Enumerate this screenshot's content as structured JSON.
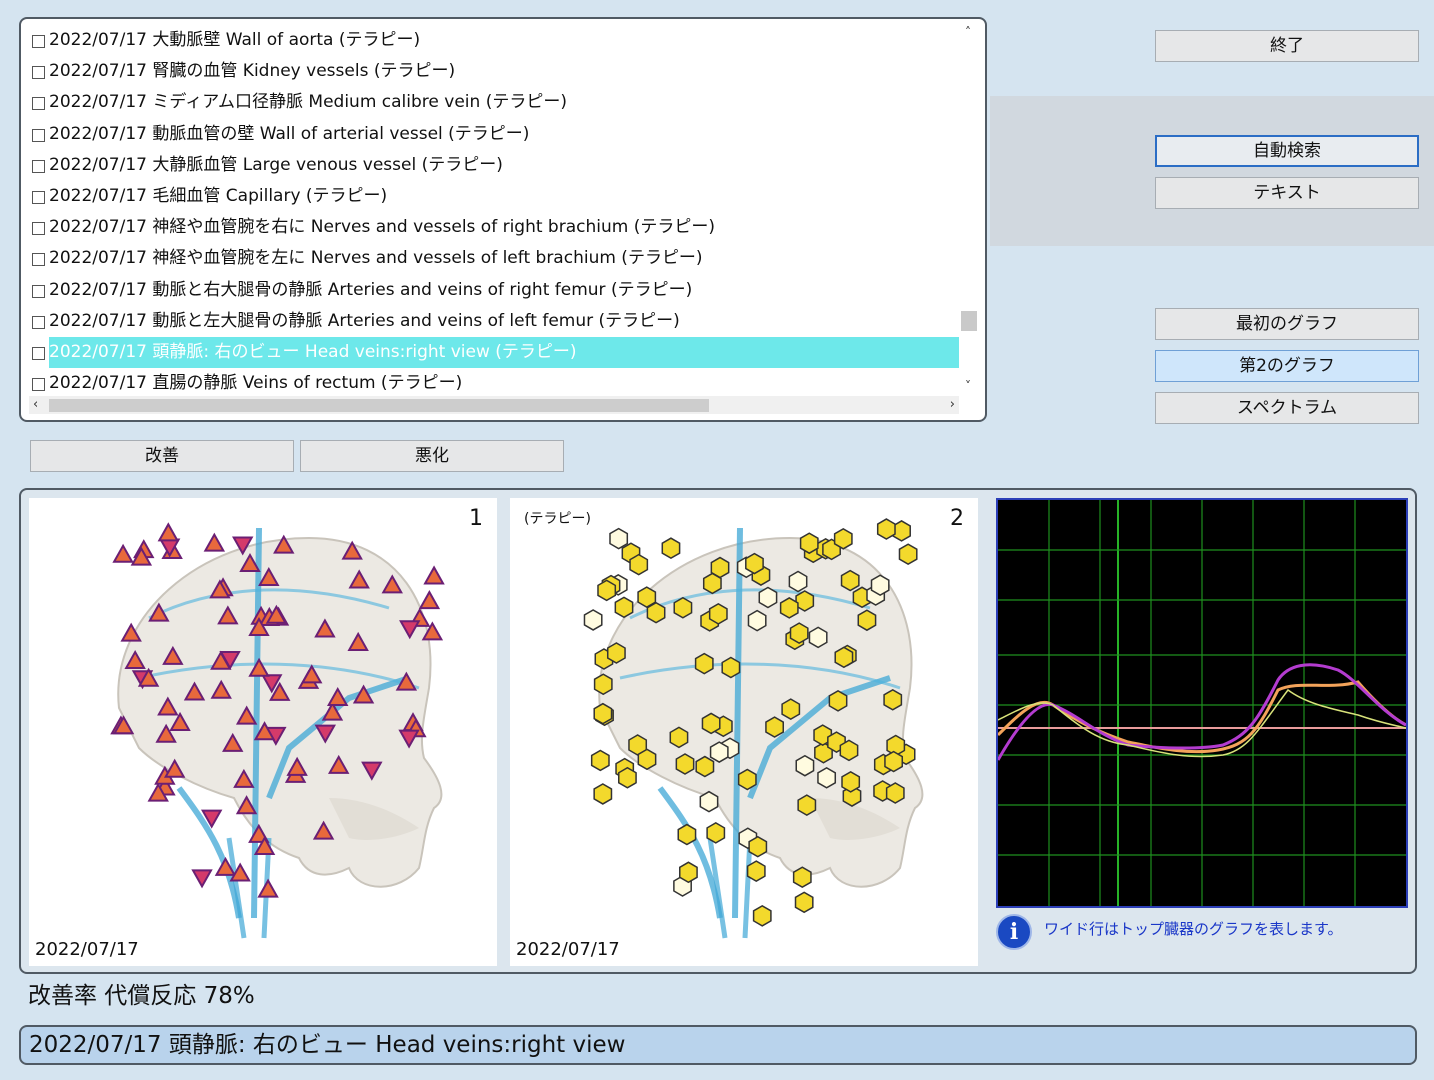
{
  "list": {
    "rows": [
      {
        "text": "2022/07/17  大動脈壁 Wall of aorta  (テラピー)",
        "selected": false
      },
      {
        "text": "2022/07/17  腎臓の血管 Kidney vessels  (テラピー)",
        "selected": false
      },
      {
        "text": "2022/07/17  ミディアム口径静脈 Medium calibre vein  (テラピー)",
        "selected": false
      },
      {
        "text": "2022/07/17  動脈血管の壁 Wall of arterial vessel  (テラピー)",
        "selected": false
      },
      {
        "text": "2022/07/17  大静脈血管 Large venous vessel  (テラピー)",
        "selected": false
      },
      {
        "text": "2022/07/17  毛細血管 Capillary  (テラピー)",
        "selected": false
      },
      {
        "text": "2022/07/17  神経や血管腕を右に Nerves and vessels of right brachium  (テラピー)",
        "selected": false
      },
      {
        "text": "2022/07/17  神経や血管腕を左に Nerves and vessels of left brachium  (テラピー)",
        "selected": false
      },
      {
        "text": "2022/07/17  動脈と右大腿骨の静脈 Arteries and veins of right femur  (テラピー)",
        "selected": false
      },
      {
        "text": "2022/07/17  動脈と左大腿骨の静脈 Arteries and veins of left femur  (テラピー)",
        "selected": false
      },
      {
        "text": "2022/07/17  頭静脈: 右のビュー Head veins:right view  (テラピー)",
        "selected": true
      },
      {
        "text": "2022/07/17  直腸の静脈 Veins of rectum  (テラピー)",
        "selected": false
      }
    ],
    "scroll_up": "˄",
    "scroll_down": "˅",
    "scroll_left": "‹",
    "scroll_right": "›"
  },
  "buttons": {
    "exit": "終了",
    "auto_search": "自動検索",
    "text": "テキスト",
    "first_graph": "最初のグラフ",
    "second_graph": "第2のグラフ",
    "spectrum": "スペクトラム",
    "improve": "改善",
    "worsen": "悪化"
  },
  "panels": {
    "panel1": {
      "number": "1",
      "date": "2022/07/17"
    },
    "panel2": {
      "number": "2",
      "date": "2022/07/17",
      "tag": "(テラピー)"
    },
    "info_text": "ワイド行はトップ臓器のグラフを表します。",
    "info_icon": "i"
  },
  "rate": {
    "label": "改善率 代償反応 78%"
  },
  "status": {
    "text": "2022/07/17 頭静脈: 右のビュー Head veins:right view"
  },
  "colors": {
    "selected_row": "#6de8ea",
    "spectrum_bg": "#000000",
    "grid": "#1f8f1f",
    "purple": "#b43cd0",
    "orange": "#f3a35a",
    "yellow_green": "#d8e27a",
    "baseline": "#e89b9b"
  }
}
